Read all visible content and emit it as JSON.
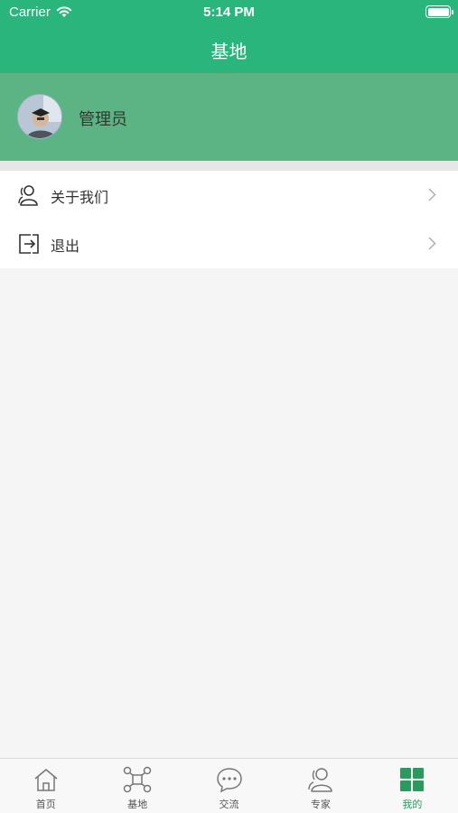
{
  "status_bar": {
    "carrier": "Carrier",
    "time": "5:14 PM"
  },
  "nav": {
    "title": "基地"
  },
  "profile": {
    "name": "管理员"
  },
  "menu": {
    "items": [
      {
        "label": "关于我们",
        "icon": "users-icon"
      },
      {
        "label": "退出",
        "icon": "logout-icon"
      }
    ]
  },
  "tabs": [
    {
      "label": "首页",
      "icon": "home-icon",
      "active": false
    },
    {
      "label": "基地",
      "icon": "network-icon",
      "active": false
    },
    {
      "label": "交流",
      "icon": "chat-icon",
      "active": false
    },
    {
      "label": "专家",
      "icon": "experts-icon",
      "active": false
    },
    {
      "label": "我的",
      "icon": "grid-icon",
      "active": true
    }
  ],
  "colors": {
    "primary": "#2ab57c",
    "profile_bg": "#5cb484",
    "active_tab": "#2a9a5e"
  }
}
